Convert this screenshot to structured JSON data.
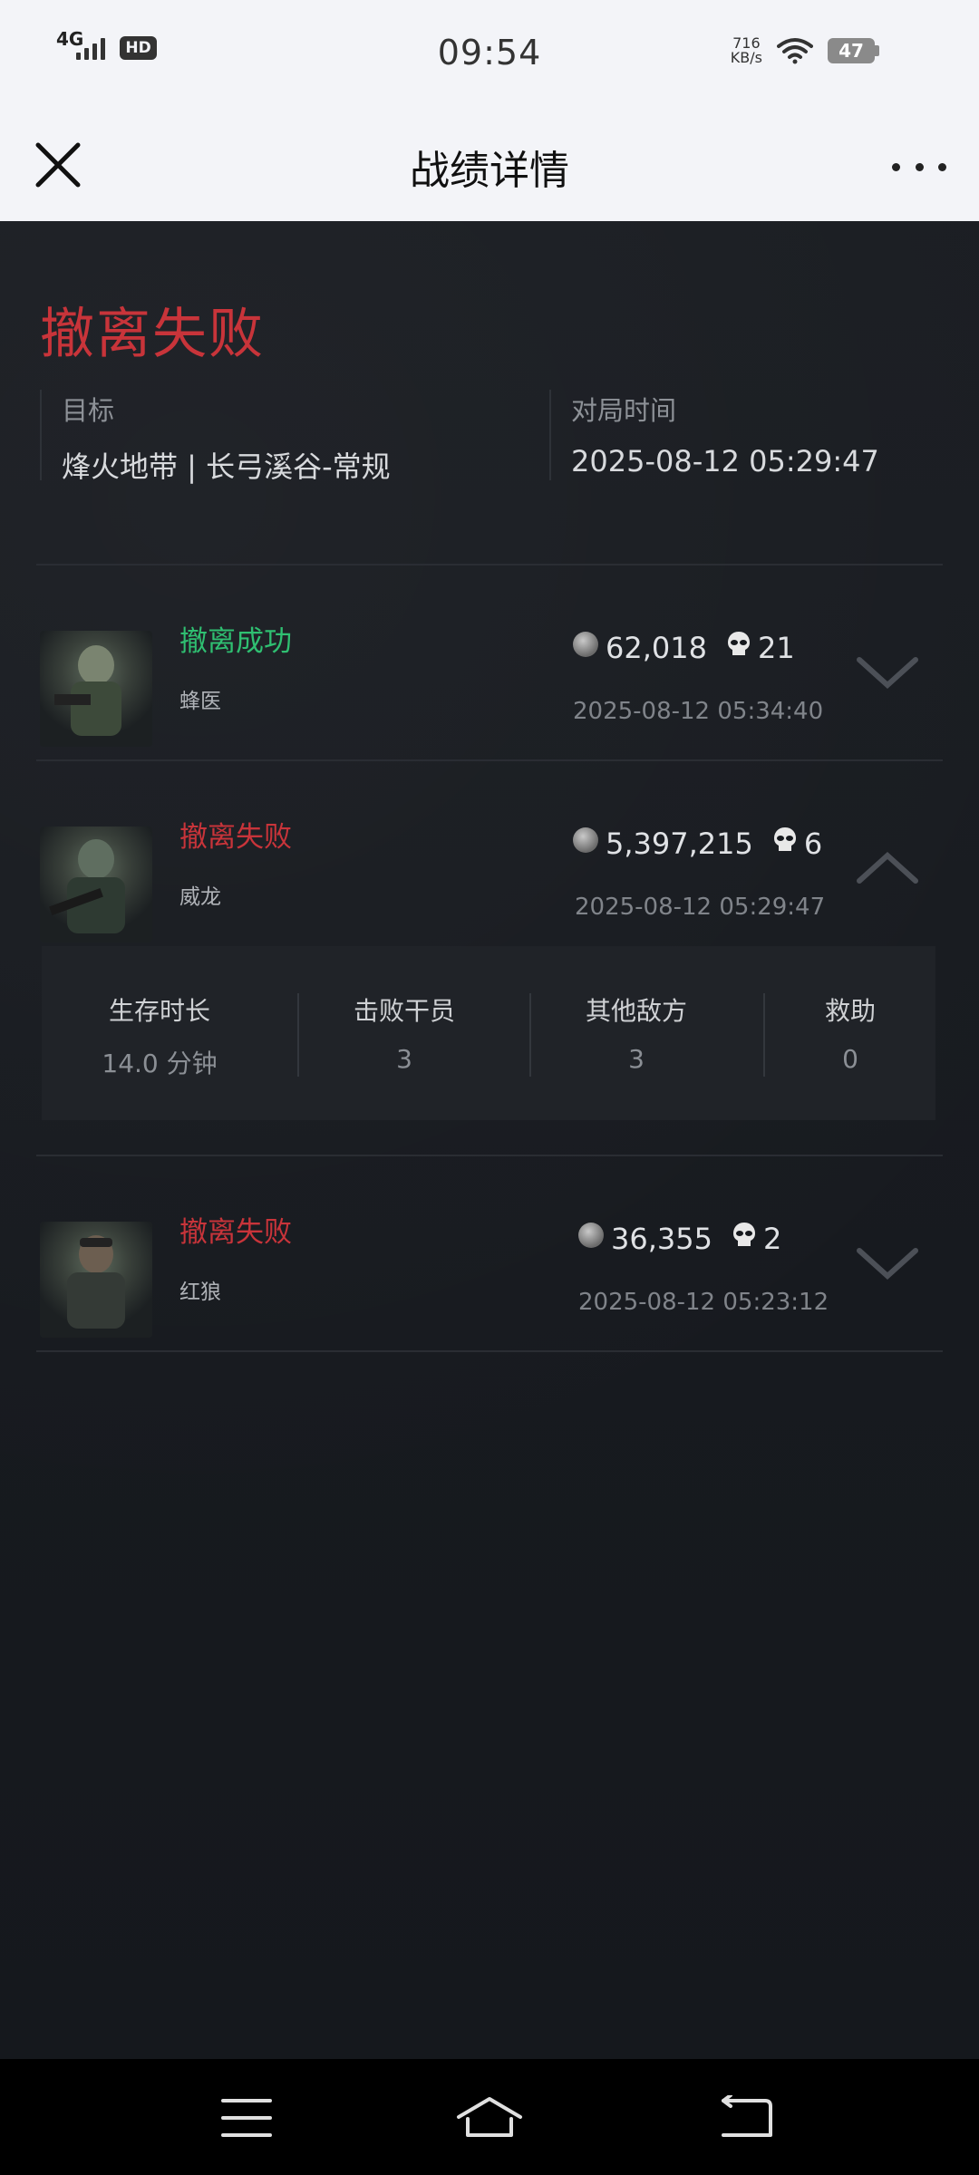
{
  "status_bar": {
    "network": "4G",
    "hd_badge": "HD",
    "time": "09:54",
    "speed_value": "716",
    "speed_unit": "KB/s",
    "battery": "47"
  },
  "header": {
    "title": "战绩详情"
  },
  "match": {
    "result": "撤离失败",
    "target_label": "目标",
    "target_value": "烽火地带 | 长弓溪谷-常规",
    "time_label": "对局时间",
    "time_value": "2025-08-12 05:29:47"
  },
  "players": [
    {
      "status": "撤离成功",
      "name": "蜂医",
      "value": "62,018",
      "kills": "21",
      "time": "2025-08-12 05:34:40",
      "expanded": false
    },
    {
      "status": "撤离失败",
      "name": "威龙",
      "value": "5,397,215",
      "kills": "6",
      "time": "2025-08-12 05:29:47",
      "expanded": true
    },
    {
      "status": "撤离失败",
      "name": "红狼",
      "value": "36,355",
      "kills": "2",
      "time": "2025-08-12 05:23:12",
      "expanded": false
    }
  ],
  "detail": {
    "survival_label": "生存时长",
    "survival_value": "14.0 分钟",
    "operators_label": "击败干员",
    "operators_value": "3",
    "other_label": "其他敌方",
    "other_value": "3",
    "assist_label": "救助",
    "assist_value": "0"
  },
  "colors": {
    "fail": "#c8343a",
    "success": "#2fbf71",
    "background": "#15181d"
  },
  "icons": {
    "close": "close-icon",
    "more": "more-icon",
    "coin": "coin-icon",
    "skull": "skull-icon",
    "chevron_down": "chevron-down-icon",
    "chevron_up": "chevron-up-icon"
  }
}
